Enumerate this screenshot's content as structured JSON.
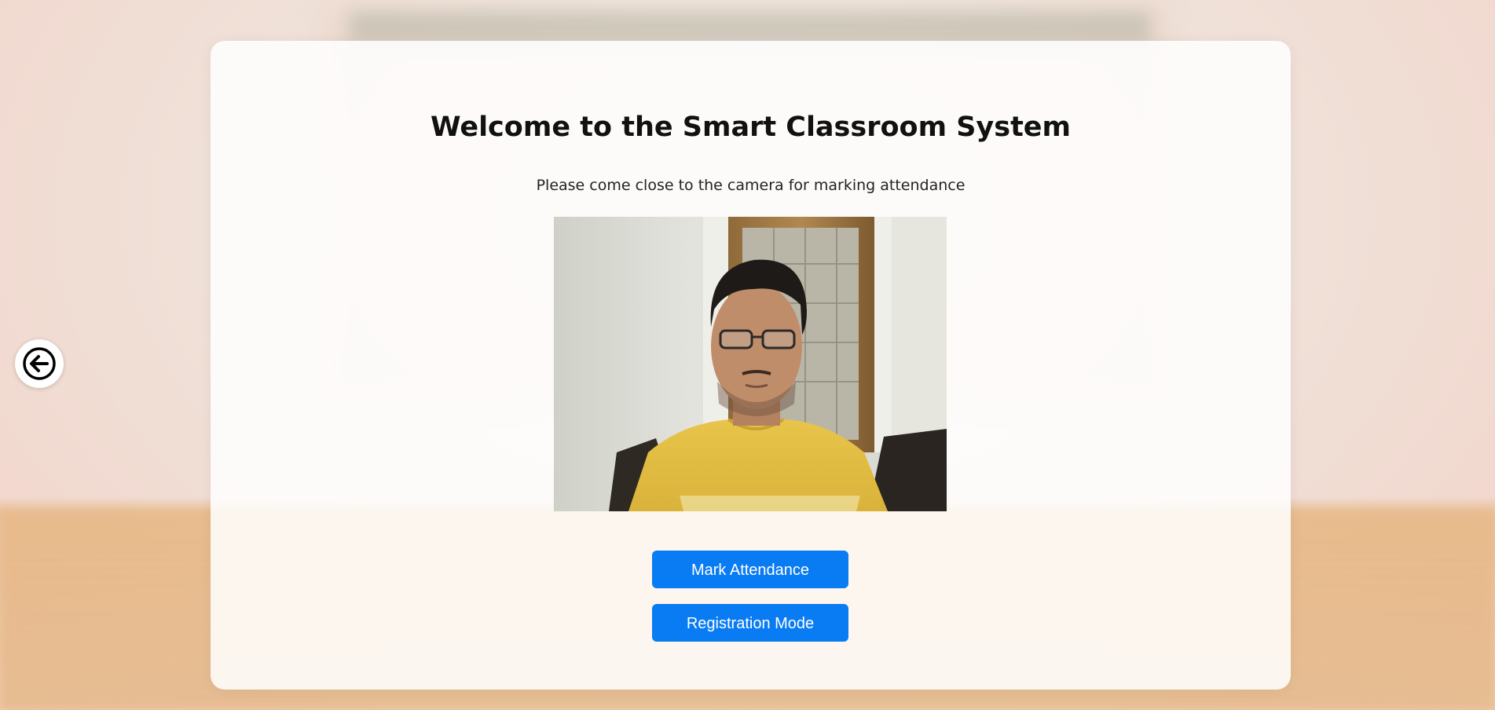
{
  "header": {
    "title": "Welcome to the Smart Classroom System",
    "subtitle": "Please come close to the camera for marking attendance"
  },
  "camera": {
    "content": "live webcam feed showing a person in a yellow t-shirt and glasses in front of a wooden door"
  },
  "actions": {
    "mark_attendance_label": "Mark Attendance",
    "registration_mode_label": "Registration Mode"
  },
  "nav": {
    "back_icon": "arrow-left-circle-icon"
  },
  "colors": {
    "primary_button": "#0a7cf3",
    "card_background": "#ffffff",
    "title_text": "#111111"
  }
}
